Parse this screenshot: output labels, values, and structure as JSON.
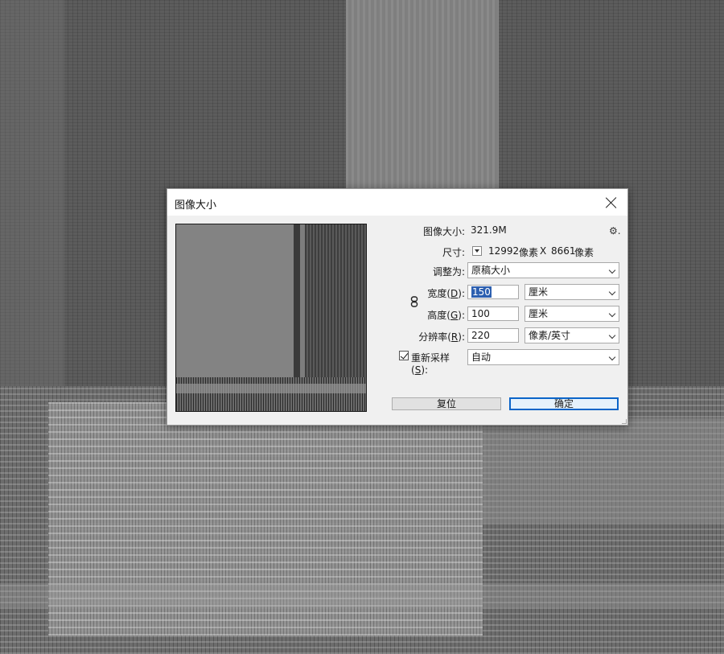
{
  "dialog": {
    "title": "图像大小",
    "image_size_label": "图像大小:",
    "image_size_value": "321.9M",
    "dimensions_label": "尺寸:",
    "dimensions_width": "12992",
    "dimensions_width_unit": "像素",
    "dimensions_x": "X",
    "dimensions_height": "8661",
    "dimensions_height_unit": "像素",
    "fit_to_label": "调整为:",
    "fit_to_value": "原稿大小",
    "width_label": "宽度",
    "width_key": "D",
    "width_value": "150",
    "width_unit": "厘米",
    "height_label": "高度",
    "height_key": "G",
    "height_value": "100",
    "height_unit": "厘米",
    "resolution_label": "分辨率",
    "resolution_key": "R",
    "resolution_value": "220",
    "resolution_unit": "像素/英寸",
    "resample_label": "重新采样",
    "resample_key": "S",
    "resample_checked": true,
    "resample_value": "自动",
    "reset_button": "复位",
    "ok_button": "确定",
    "gear_icon": "⚙.",
    "colors": {
      "ok_border": "#0a64c8",
      "selection": "#2c5fb0"
    }
  }
}
